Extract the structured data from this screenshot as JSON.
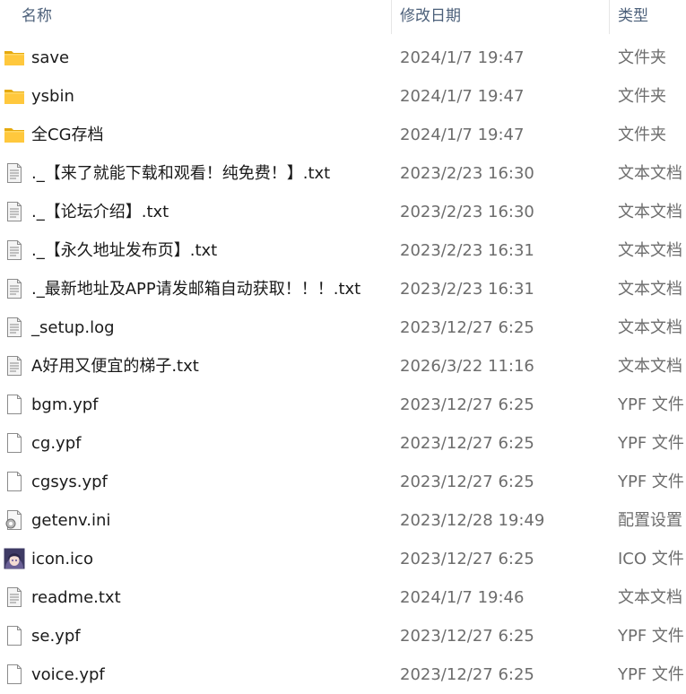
{
  "columns": {
    "name": "名称",
    "date": "修改日期",
    "type": "类型"
  },
  "files": [
    {
      "name": "save",
      "date": "2024/1/7 19:47",
      "type": "文件夹",
      "icon": "folder-icon"
    },
    {
      "name": "ysbin",
      "date": "2024/1/7 19:47",
      "type": "文件夹",
      "icon": "folder-icon"
    },
    {
      "name": "全CG存档",
      "date": "2024/1/7 19:47",
      "type": "文件夹",
      "icon": "folder-icon"
    },
    {
      "name": "._【来了就能下载和观看！纯免费！】.txt",
      "date": "2023/2/23 16:30",
      "type": "文本文档",
      "icon": "text-file-icon"
    },
    {
      "name": "._【论坛介绍】.txt",
      "date": "2023/2/23 16:30",
      "type": "文本文档",
      "icon": "text-file-icon"
    },
    {
      "name": "._【永久地址发布页】.txt",
      "date": "2023/2/23 16:31",
      "type": "文本文档",
      "icon": "text-file-icon"
    },
    {
      "name": "._最新地址及APP请发邮箱自动获取！！！.txt",
      "date": "2023/2/23 16:31",
      "type": "文本文档",
      "icon": "text-file-icon"
    },
    {
      "name": "_setup.log",
      "date": "2023/12/27 6:25",
      "type": "文本文档",
      "icon": "text-file-icon"
    },
    {
      "name": "A好用又便宜的梯子.txt",
      "date": "2026/3/22 11:16",
      "type": "文本文档",
      "icon": "text-file-icon"
    },
    {
      "name": "bgm.ypf",
      "date": "2023/12/27 6:25",
      "type": "YPF 文件",
      "icon": "blank-file-icon"
    },
    {
      "name": "cg.ypf",
      "date": "2023/12/27 6:25",
      "type": "YPF 文件",
      "icon": "blank-file-icon"
    },
    {
      "name": "cgsys.ypf",
      "date": "2023/12/27 6:25",
      "type": "YPF 文件",
      "icon": "blank-file-icon"
    },
    {
      "name": "getenv.ini",
      "date": "2023/12/28 19:49",
      "type": "配置设置",
      "icon": "settings-file-icon"
    },
    {
      "name": "icon.ico",
      "date": "2023/12/27 6:25",
      "type": "ICO 文件",
      "icon": "image-file-icon"
    },
    {
      "name": "readme.txt",
      "date": "2024/1/7 19:46",
      "type": "文本文档",
      "icon": "text-file-icon"
    },
    {
      "name": "se.ypf",
      "date": "2023/12/27 6:25",
      "type": "YPF 文件",
      "icon": "blank-file-icon"
    },
    {
      "name": "voice.ypf",
      "date": "2023/12/27 6:25",
      "type": "YPF 文件",
      "icon": "blank-file-icon"
    }
  ]
}
